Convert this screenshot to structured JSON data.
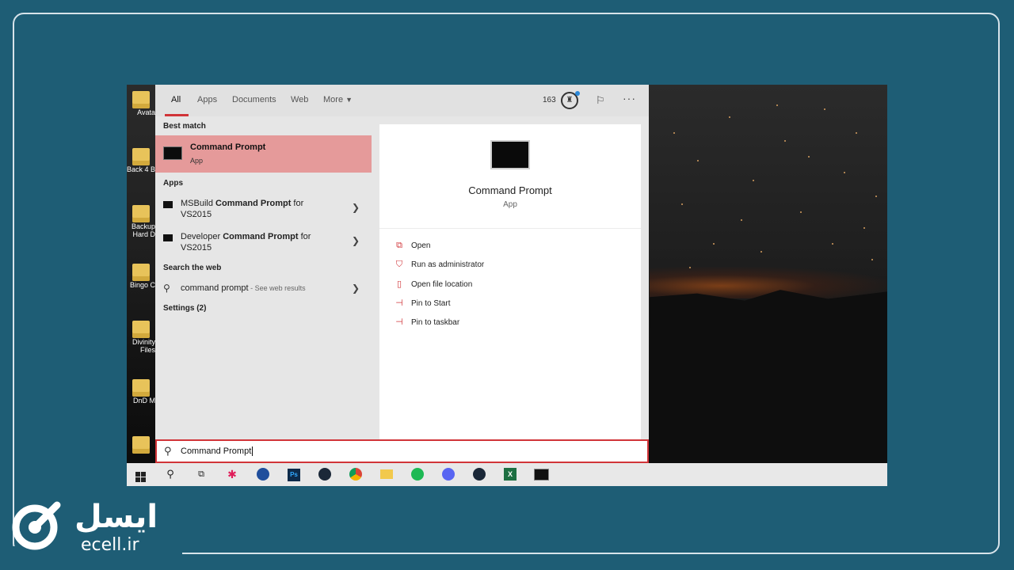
{
  "search_tabs": {
    "all": "All",
    "apps": "Apps",
    "documents": "Documents",
    "web": "Web",
    "more": "More"
  },
  "header": {
    "points_count": "163"
  },
  "sections": {
    "best_match": "Best match",
    "apps": "Apps",
    "search_web": "Search the web",
    "settings": "Settings (2)"
  },
  "best_match": {
    "title": "Command Prompt",
    "subtitle": "App"
  },
  "apps": [
    {
      "prefix": "MSBuild ",
      "bold": "Command Prompt",
      "suffix": " for",
      "line2": "VS2015"
    },
    {
      "prefix": "Developer ",
      "bold": "Command Prompt",
      "suffix": " for",
      "line2": "VS2015"
    }
  ],
  "web_result": {
    "query": "command prompt",
    "hint": " - See web results"
  },
  "detail": {
    "title": "Command Prompt",
    "subtitle": "App",
    "actions": [
      "Open",
      "Run as administrator",
      "Open file location",
      "Pin to Start",
      "Pin to taskbar"
    ]
  },
  "search_box": {
    "value": "Command Prompt"
  },
  "desktop_icons": [
    "Avata",
    "Back 4 B",
    "Backup Hard D",
    "Bingo C",
    "Divinity Files",
    "DnD M",
    ""
  ],
  "taskbar_icons": [
    "start-icon",
    "search-icon",
    "task-view-icon",
    "slack-icon",
    "onedrive-icon",
    "photoshop-icon",
    "steam-icon",
    "chrome-icon",
    "file-explorer-icon",
    "spotify-icon",
    "discord-icon",
    "steam-icon-2",
    "excel-icon",
    "cmd-icon"
  ],
  "logo": {
    "fa": "ایسل",
    "en": "ecell.ir"
  },
  "colors": {
    "background": "#1e5d75",
    "accent_red": "#d13438",
    "best_match_highlight": "#e59a9a"
  }
}
